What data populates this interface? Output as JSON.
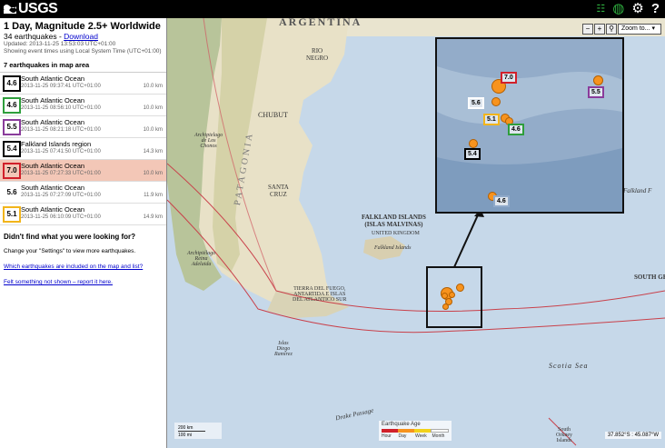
{
  "brand": {
    "name": "USGS"
  },
  "sidebar": {
    "title": "1 Day, Magnitude 2.5+ Worldwide",
    "count_text": "34 earthquakes - ",
    "download_label": "Download",
    "updated": "Updated: 2013-11-25 13:53:03 UTC+01:00",
    "timezone_note": "Showing event times using Local System Time (UTC+01:00)",
    "in_map_area": "7 earthquakes in map area",
    "earthquakes": [
      {
        "mag": "4.6",
        "place": "South Atlantic Ocean",
        "time": "2013-11-25 09:37:41 UTC+01:00",
        "depth": "10.0 km",
        "color": "#000000"
      },
      {
        "mag": "4.6",
        "place": "South Atlantic Ocean",
        "time": "2013-11-25 08:56:10 UTC+01:00",
        "depth": "10.0 km",
        "color": "#2e9e3c"
      },
      {
        "mag": "5.5",
        "place": "South Atlantic Ocean",
        "time": "2013-11-25 08:21:18 UTC+01:00",
        "depth": "10.0 km",
        "color": "#8a3c9b"
      },
      {
        "mag": "5.4",
        "place": "Falkland Islands region",
        "time": "2013-11-25 07:41:50 UTC+01:00",
        "depth": "14.3 km",
        "color": "#000000"
      },
      {
        "mag": "7.0",
        "place": "South Atlantic Ocean",
        "time": "2013-11-25 07:27:33 UTC+01:00",
        "depth": "10.0 km",
        "color": "#d1202a"
      },
      {
        "mag": "5.6",
        "place": "South Atlantic Ocean",
        "time": "2013-11-25 07:27:09 UTC+01:00",
        "depth": "11.9 km",
        "color": "#ffffff"
      },
      {
        "mag": "5.1",
        "place": "South Atlantic Ocean",
        "time": "2013-11-25 06:10:09 UTC+01:00",
        "depth": "14.9 km",
        "color": "#f2b51b"
      }
    ],
    "help_title": "Didn't find what you were looking for?",
    "help_text": "Change your \"Settings\" to view more earthquakes.",
    "help_link1": "Which earthquakes are included on the map and list?",
    "help_link2": "Felt something not shown – report it here."
  },
  "map": {
    "labels": {
      "argentina": "ARGENTINA",
      "rio_negro": "RIO\nNEGRO",
      "chubut": "CHUBUT",
      "santa_cruz": "SANTA\nCRUZ",
      "patagonia": "PATAGONIA",
      "chonos": "Archipielago\nde Los\nChonos",
      "reina_adelaida": "Archipiélago\nReina\nAdelaida",
      "tierra_del_fuego": "TIERRA DEL FUEGO,\nANTARTIDA E ISLAS\nDEL ATLANTICO SUR",
      "diego_ramirez": "Islas\nDiego\nRamírez",
      "drake": "Drake Passage",
      "falkland": "FALKLAND ISLANDS\n(ISLAS MALVINAS)",
      "uk": "UNITED KINGDOM",
      "falkland_islands": "Falkland Islands",
      "falkland_right": "Falkland F",
      "scotia": "Scotia Sea",
      "south_ge": "SOUTH GE",
      "south_orkney": "South\nOrkney\nIslands"
    },
    "inset_labels": [
      {
        "mag": "7.0",
        "color": "#d1202a"
      },
      {
        "mag": "5.5",
        "color": "#8a3c9b"
      },
      {
        "mag": "5.6",
        "color": "#ffffff"
      },
      {
        "mag": "5.1",
        "color": "#f2b51b"
      },
      {
        "mag": "4.6",
        "color": "#2e9e3c"
      },
      {
        "mag": "5.4",
        "color": "#000000"
      },
      {
        "mag": "4.6",
        "color": "#8fa9c9"
      }
    ],
    "zoom_label": "Zoom to...",
    "legend_title": "Earthquake Age",
    "legend_items": [
      "Hour",
      "Day",
      "Week",
      "Month"
    ],
    "scale": {
      "km": "200 km",
      "mi": "100 mi"
    },
    "coords": "37.852°S : 45.087°W"
  }
}
